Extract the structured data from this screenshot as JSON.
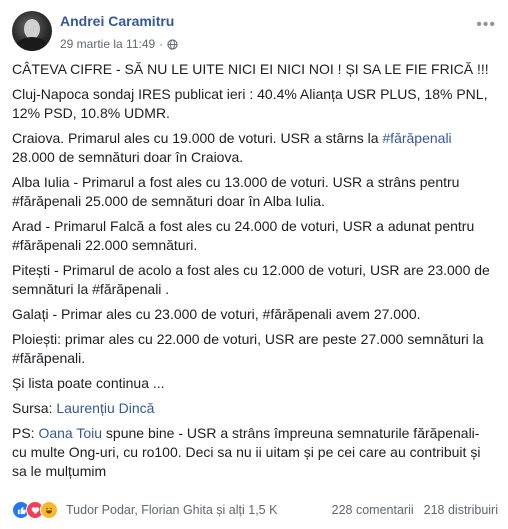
{
  "post": {
    "author": "Andrei Caramitru",
    "timestamp": "29 martie la 11:49",
    "dot": "·",
    "paragraphs": {
      "p1": "CÂTEVA CIFRE - SĂ NU LE UITE NICI EI NICI NOI ! ȘI SA LE FIE FRICĂ !!!",
      "p2": "Cluj-Napoca sondaj IRES publicat ieri : 40.4% Alianța USR PLUS, 18% PNL, 12% PSD, 10.8% UDMR.",
      "p3a": "Craiova. Primarul ales cu 19.000 de voturi. USR a stârns la ",
      "p3tag": "#fărăpenali",
      "p3b": " 28.000 de semnături doar în Craiova.",
      "p4": "Alba Iulia - Primarul a fost ales cu 13.000 de voturi. USR a strâns pentru #fărăpenali 25.000 de semnături doar în Alba Iulia.",
      "p5": "Arad - Primarul Falcă a fost ales cu 24.000 de voturi, USR a adunat pentru #fărăpenali 22.000 semnături.",
      "p6": "Pitești - Primarul de acolo a fost ales cu 12.000 de voturi, USR are 23.000 de semnături la #fărăpenali .",
      "p7": "Galați - Primar ales cu 23.000 de voturi, #fărăpenali avem 27.000.",
      "p8": "Ploiești: primar ales cu 22.000 de voturi, USR are peste 27.000 semnături la #fărăpenali.",
      "p9": "Și lista poate continua ...",
      "p10a": "Sursa: ",
      "p10link": "Laurențiu Dincă",
      "p11a": "PS: ",
      "p11link": "Oana Toiu",
      "p11b": " spune bine - USR a strâns împreuna semnaturile fărăpenali- cu multe Ong-uri, cu ro100. Deci sa nu ii uitam și pe cei care au contribuit și sa le mulțumim"
    }
  },
  "footer": {
    "names": "Tudor Podar, Florian Ghita și alți 1,5 K",
    "comments": "228 comentarii",
    "shares": "218 distribuiri"
  },
  "icons": {
    "more": "more-options-icon",
    "globe": "globe-icon",
    "like": "like-reaction-icon",
    "love": "love-reaction-icon",
    "haha": "haha-reaction-icon"
  },
  "colors": {
    "link": "#365899",
    "like": "#2078f4",
    "love": "#f33e58",
    "haha": "#f7b928"
  }
}
